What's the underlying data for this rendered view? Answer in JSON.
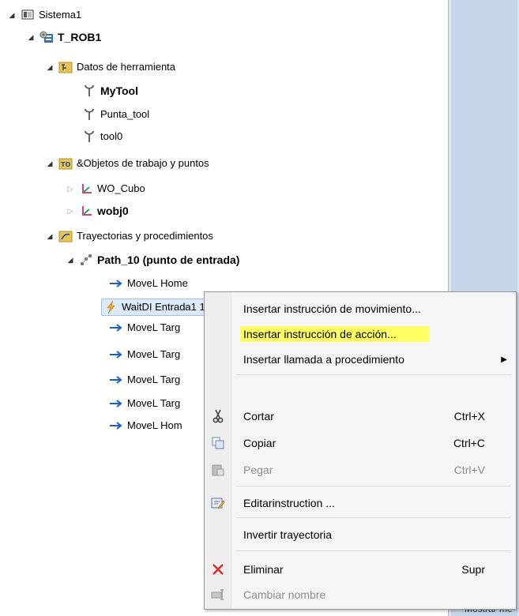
{
  "tree": {
    "sistema": "Sistema1",
    "task": "T_ROB1",
    "tooldata_folder": "Datos de herramienta",
    "tools": [
      "MyTool",
      "Punta_tool",
      "tool0"
    ],
    "wobj_folder": "&Objetos de trabajo y puntos",
    "wobjs": [
      "WO_Cubo",
      "wobj0"
    ],
    "paths_folder": "Trayectorias y procedimientos",
    "path": "Path_10 (punto de entrada)",
    "instructions": [
      "MoveL Home",
      "WaitDI Entrada1 1",
      "MoveL Targ",
      "MoveL Targ",
      "MoveL Targ",
      "MoveL Targ",
      "MoveL Hom"
    ]
  },
  "context_menu": {
    "items": [
      {
        "label": "Insertar instrucción de movimiento...",
        "shortcut": ""
      },
      {
        "label": "Insertar instrucción de acción...",
        "shortcut": ""
      },
      {
        "label": "Insertar llamada a procedimiento",
        "shortcut": ""
      },
      {
        "label": "Cortar",
        "shortcut": "Ctrl+X"
      },
      {
        "label": "Copiar",
        "shortcut": "Ctrl+C"
      },
      {
        "label": "Pegar",
        "shortcut": "Ctrl+V"
      },
      {
        "label": "Editarinstruction ...",
        "shortcut": ""
      },
      {
        "label": "Invertir trayectoria",
        "shortcut": ""
      },
      {
        "label": "Eliminar",
        "shortcut": "Supr"
      },
      {
        "label": "Cambiar nombre",
        "shortcut": ""
      }
    ]
  },
  "status_fragment": "Mostrar me",
  "colors": {
    "highlight": "#ffff66",
    "selection": "#dce9f8",
    "arrow": "#1f5fbf"
  }
}
